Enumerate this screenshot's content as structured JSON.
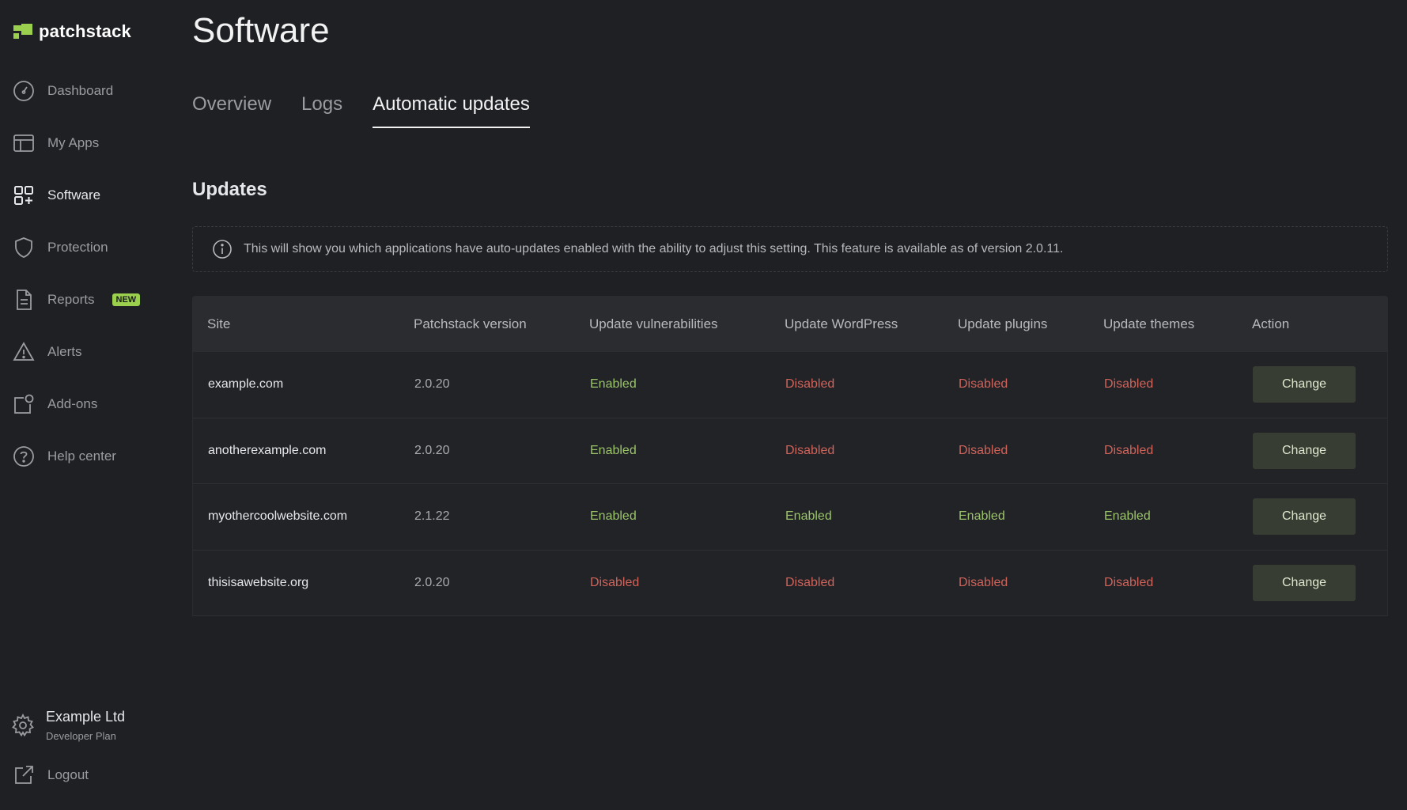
{
  "brand": {
    "name": "patchstack",
    "accent": "#9bd04f"
  },
  "sidebar": {
    "items": [
      {
        "label": "Dashboard",
        "icon": "gauge-icon"
      },
      {
        "label": "My Apps",
        "icon": "layout-icon"
      },
      {
        "label": "Software",
        "icon": "grid-plus-icon"
      },
      {
        "label": "Protection",
        "icon": "shield-icon"
      },
      {
        "label": "Reports",
        "icon": "document-icon",
        "badge": "NEW"
      },
      {
        "label": "Alerts",
        "icon": "warning-icon"
      },
      {
        "label": "Add-ons",
        "icon": "addons-icon"
      },
      {
        "label": "Help center",
        "icon": "help-icon"
      }
    ],
    "account": {
      "name": "Example Ltd",
      "plan": "Developer Plan",
      "icon": "gear-icon"
    },
    "logout": {
      "label": "Logout",
      "icon": "external-link-icon"
    }
  },
  "page": {
    "title": "Software",
    "tabs": [
      "Overview",
      "Logs",
      "Automatic updates"
    ],
    "active_tab": "Automatic updates",
    "section_title": "Updates",
    "info_text": "This will show you which applications have auto-updates enabled with the ability to adjust this setting. This feature is available as of version 2.0.11."
  },
  "table": {
    "columns": [
      "Site",
      "Patchstack version",
      "Update vulnerabilities",
      "Update WordPress",
      "Update plugins",
      "Update themes",
      "Action"
    ],
    "rows": [
      {
        "site": "example.com",
        "version": "2.0.20",
        "vulnerabilities": "Enabled",
        "wordpress": "Disabled",
        "plugins": "Disabled",
        "themes": "Disabled",
        "action": "Change"
      },
      {
        "site": "anotherexample.com",
        "version": "2.0.20",
        "vulnerabilities": "Enabled",
        "wordpress": "Disabled",
        "plugins": "Disabled",
        "themes": "Disabled",
        "action": "Change"
      },
      {
        "site": "myothercoolwebsite.com",
        "version": "2.1.22",
        "vulnerabilities": "Enabled",
        "wordpress": "Enabled",
        "plugins": "Enabled",
        "themes": "Enabled",
        "action": "Change"
      },
      {
        "site": "thisisawebsite.org",
        "version": "2.0.20",
        "vulnerabilities": "Disabled",
        "wordpress": "Disabled",
        "plugins": "Disabled",
        "themes": "Disabled",
        "action": "Change"
      }
    ]
  },
  "colors": {
    "background": "#1f2024",
    "enabled": "#9bc46a",
    "disabled": "#d0635a",
    "button": "#383d33"
  }
}
